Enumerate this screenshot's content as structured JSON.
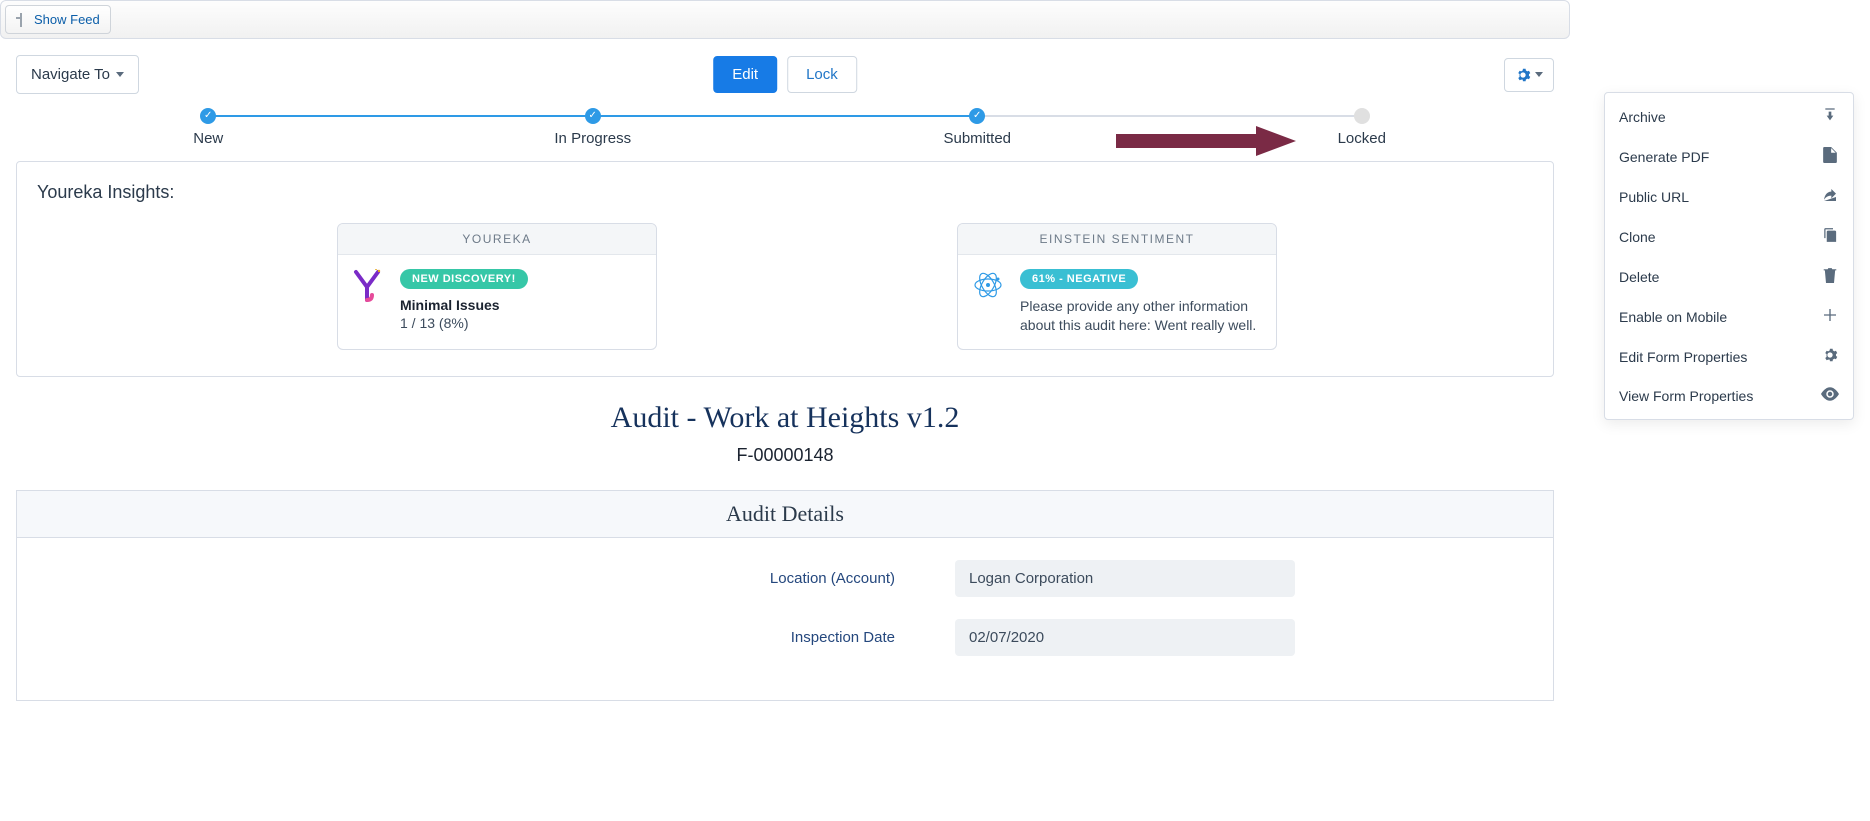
{
  "topbar": {
    "show_feed": "Show Feed"
  },
  "actions": {
    "navigate_to": "Navigate To",
    "edit": "Edit",
    "lock": "Lock"
  },
  "path": [
    {
      "label": "New",
      "state": "done",
      "line": "done"
    },
    {
      "label": "In Progress",
      "state": "done",
      "line": "done"
    },
    {
      "label": "Submitted",
      "state": "done",
      "line": "pending"
    },
    {
      "label": "Locked",
      "state": "pending",
      "line": "pending"
    }
  ],
  "insights": {
    "title": "Youreka Insights:",
    "youreka": {
      "hdr": "YOUREKA",
      "pill": "NEW DISCOVERY!",
      "strong": "Minimal Issues",
      "sub": "1 / 13 (8%)"
    },
    "einstein": {
      "hdr": "EINSTEIN SENTIMENT",
      "pill": "61% - NEGATIVE",
      "para": "Please provide any other information about this audit here: Went really well."
    }
  },
  "form": {
    "title": "Audit - Work at Heights v1.2",
    "id": "F-00000148"
  },
  "details": {
    "hdr": "Audit Details",
    "fields": [
      {
        "label": "Location (Account)",
        "value": "Logan Corporation"
      },
      {
        "label": "Inspection Date",
        "value": "02/07/2020"
      }
    ]
  },
  "menu": [
    {
      "label": "Archive",
      "icon": "download"
    },
    {
      "label": "Generate PDF",
      "icon": "file"
    },
    {
      "label": "Public URL",
      "icon": "share"
    },
    {
      "label": "Clone",
      "icon": "copy"
    },
    {
      "label": "Delete",
      "icon": "trash"
    },
    {
      "label": "Enable on Mobile",
      "icon": "plus"
    },
    {
      "label": "Edit Form Properties",
      "icon": "gear"
    },
    {
      "label": "View Form Properties",
      "icon": "eye"
    }
  ]
}
